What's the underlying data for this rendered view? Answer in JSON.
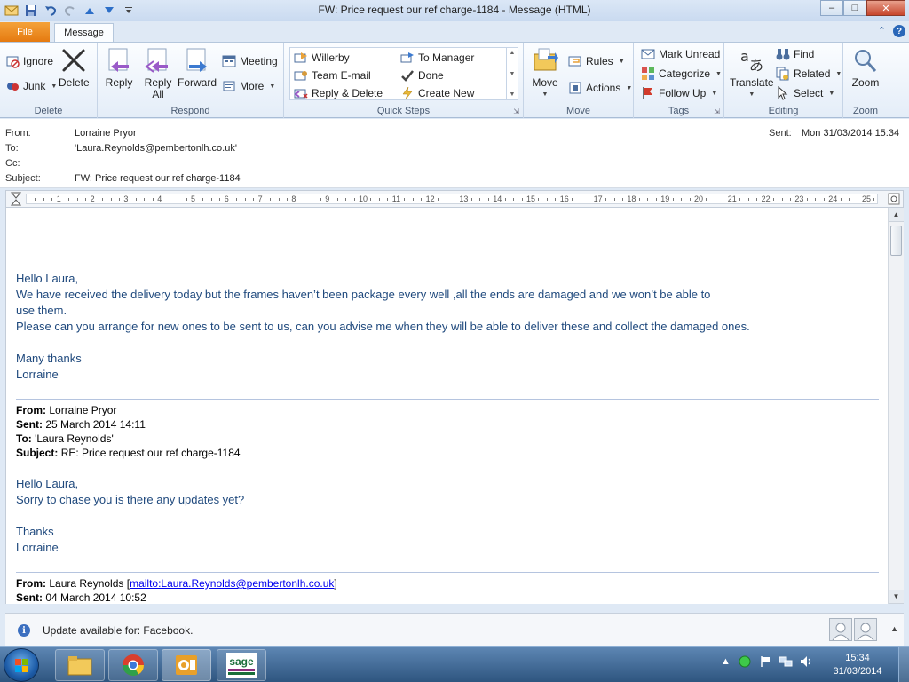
{
  "window": {
    "title": "FW: Price request our ref charge-1184  -  Message (HTML)",
    "minimize": "–",
    "maximize": "□",
    "close": "✕"
  },
  "tabs": {
    "file": "File",
    "message": "Message"
  },
  "ribbon": {
    "delete_group": {
      "label": "Delete",
      "ignore": "Ignore",
      "junk": "Junk",
      "delete": "Delete"
    },
    "respond_group": {
      "label": "Respond",
      "reply": "Reply",
      "reply_all_1": "Reply",
      "reply_all_2": "All",
      "forward": "Forward",
      "meeting": "Meeting",
      "more": "More"
    },
    "quick_steps": {
      "label": "Quick Steps",
      "items": [
        "Willerby",
        "To Manager",
        "Team E-mail",
        "Done",
        "Reply & Delete",
        "Create New"
      ]
    },
    "move_group": {
      "label": "Move",
      "move": "Move",
      "rules": "Rules",
      "actions": "Actions"
    },
    "tags_group": {
      "label": "Tags",
      "mark_unread": "Mark Unread",
      "categorize": "Categorize",
      "follow_up": "Follow Up"
    },
    "editing_group": {
      "label": "Editing",
      "translate": "Translate",
      "find": "Find",
      "related": "Related",
      "select": "Select"
    },
    "zoom_group": {
      "label": "Zoom",
      "zoom": "Zoom"
    }
  },
  "header": {
    "from_label": "From:",
    "from": "Lorraine Pryor",
    "to_label": "To:",
    "to": "'Laura.Reynolds@pembertonlh.co.uk'",
    "cc_label": "Cc:",
    "cc": "",
    "subject_label": "Subject:",
    "subject": "FW: Price request our ref charge-1184",
    "sent_label": "Sent:",
    "sent": "Mon 31/03/2014 15:34"
  },
  "ruler": {
    "numbers": [
      "1",
      "2",
      "3",
      "4",
      "5",
      "6",
      "7",
      "8",
      "9",
      "10",
      "11",
      "12",
      "13",
      "14",
      "15",
      "16",
      "17",
      "18",
      "19",
      "20",
      "21",
      "22",
      "23",
      "24",
      "25"
    ]
  },
  "body": {
    "greeting": "Hello Laura,",
    "line1": "We have received the delivery today but the frames haven’t been package every well ,all the ends are damaged and we won’t be able to",
    "line2": "use them.",
    "line3": "Please can you arrange for new ones to be sent to us, can you advise me when they will be able to deliver these and collect the damaged ones.",
    "thanks": "Many thanks",
    "sign": "Lorraine",
    "quoted1": {
      "from_label": "From:",
      "from": "Lorraine Pryor",
      "sent_label": "Sent:",
      "sent": "25 March 2014 14:11",
      "to_label": "To:",
      "to": "'Laura Reynolds'",
      "subject_label": "Subject:",
      "subject": "RE: Price request our ref charge-1184",
      "greeting": "Hello Laura,",
      "text": "Sorry to chase you is there any updates yet?",
      "thanks": "Thanks",
      "sign": "Lorraine"
    },
    "quoted2": {
      "from_label": "From:",
      "from": "Laura Reynolds",
      "mailto": "mailto:Laura.Reynolds@pembertonlh.co.uk",
      "sent_label": "Sent:",
      "sent": "04 March 2014 10:52"
    }
  },
  "infobar": {
    "text": "Update available for: Facebook.",
    "icon": "i"
  },
  "taskbar": {
    "time": "15:34",
    "date": "31/03/2014",
    "sage_label": "sage"
  }
}
